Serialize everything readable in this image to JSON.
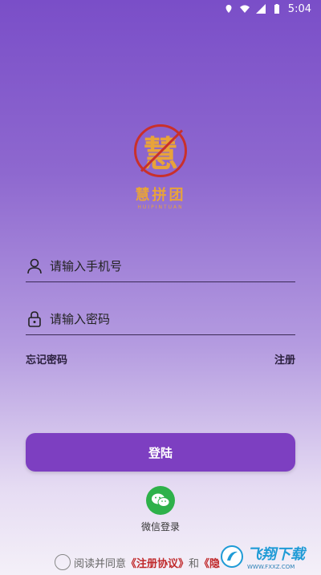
{
  "status_bar": {
    "time": "5:04"
  },
  "logo": {
    "title": "慧拼团",
    "subtitle": "HUIPINTUAN",
    "glyph": "慧"
  },
  "phone_field": {
    "placeholder": "请输入手机号",
    "icon": "user-icon"
  },
  "password_field": {
    "placeholder": "请输入密码",
    "icon": "lock-icon"
  },
  "links": {
    "forgot": "忘记密码",
    "register": "注册"
  },
  "login_button": {
    "label": "登陆",
    "color": "#7d3fc1"
  },
  "wechat": {
    "label": "微信登录",
    "icon": "wechat-icon",
    "color": "#2eb14a"
  },
  "agreement": {
    "prefix": "阅读并同意",
    "terms": "《注册协议》",
    "and": "和",
    "privacy": "《隐"
  },
  "watermark": {
    "text": "飞翔下载",
    "sub": "WWW.FXXZ.COM"
  }
}
